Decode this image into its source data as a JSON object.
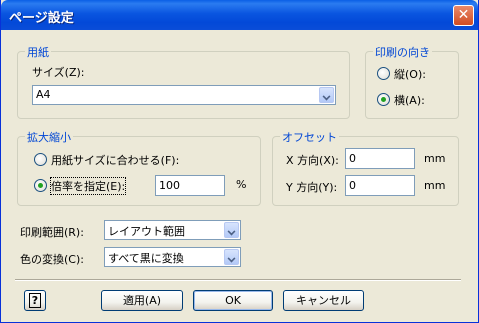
{
  "window": {
    "title": "ページ設定",
    "close_label": "✕"
  },
  "paper": {
    "group_title": "用紙",
    "size_label": "サイズ(Z):",
    "size_value": "A4"
  },
  "orientation": {
    "group_title": "印刷の向き",
    "portrait_label": "縦(O):",
    "landscape_label": "横(A):",
    "selected": "landscape"
  },
  "scale": {
    "group_title": "拡大縮小",
    "fit_label": "用紙サイズに合わせる(F):",
    "percent_label": "倍率を指定(E):",
    "percent_value": "100",
    "percent_unit": "%",
    "selected": "percent"
  },
  "offset": {
    "group_title": "オフセット",
    "x_label": "X 方向(X):",
    "x_value": "0",
    "x_unit": "mm",
    "y_label": "Y 方向(Y):",
    "y_value": "0",
    "y_unit": "mm"
  },
  "print_range": {
    "label": "印刷範囲(R):",
    "value": "レイアウト範囲"
  },
  "color_conversion": {
    "label": "色の変換(C):",
    "value": "すべて黒に変換"
  },
  "buttons": {
    "help_label": "?",
    "apply_label": "適用(A)",
    "ok_label": "OK",
    "cancel_label": "キャンセル"
  },
  "colors": {
    "title_bar": "#0a55e0",
    "group_title": "#0046d5",
    "dialog_bg": "#ece9d8",
    "radio_dot": "#21a121"
  }
}
